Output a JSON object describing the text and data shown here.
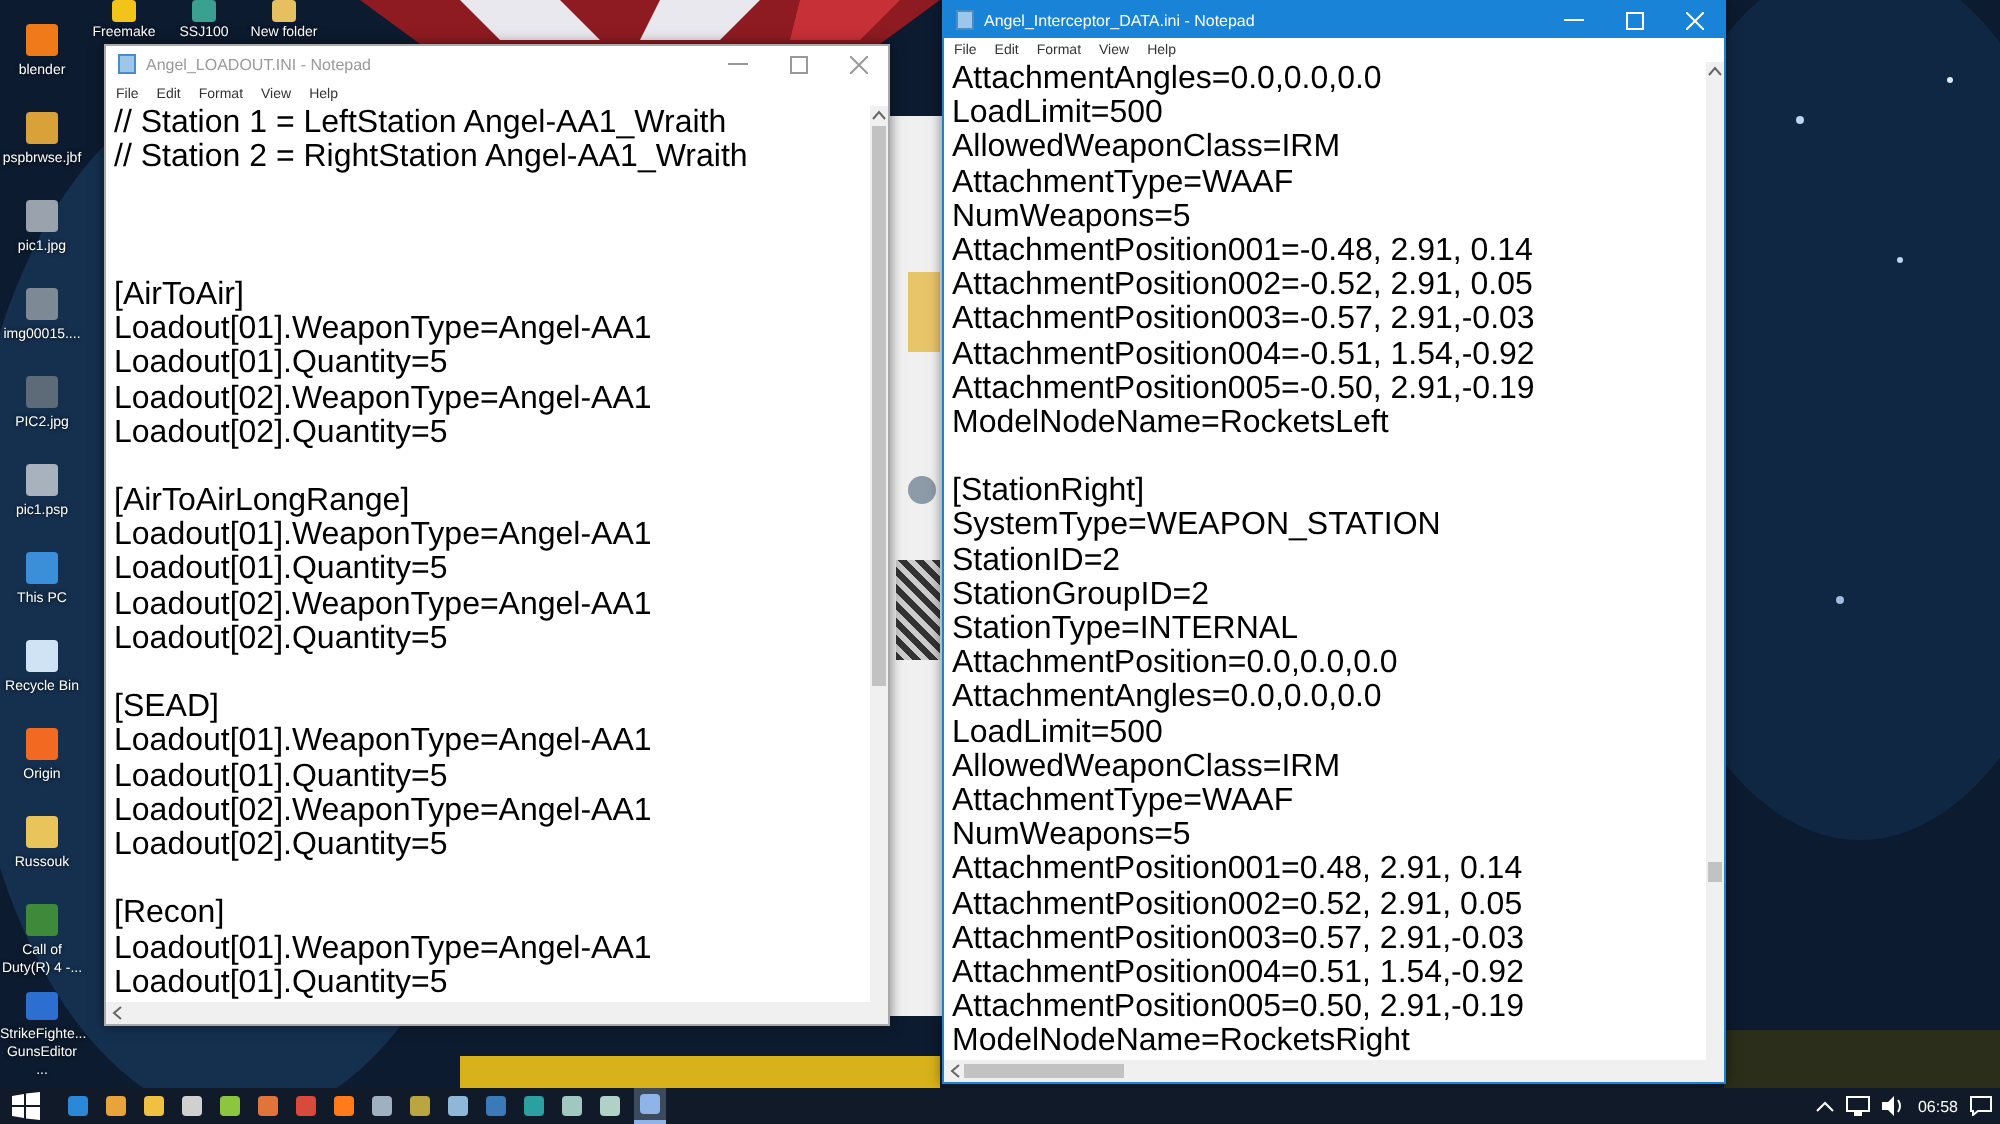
{
  "desktop_icons": [
    {
      "label": "blender",
      "color": "#f07a1a"
    },
    {
      "label": "pspbrwse.jbf",
      "color": "#d9a13a"
    },
    {
      "label": "pic1.jpg",
      "color": "#9aa3ad"
    },
    {
      "label": "img00015....",
      "color": "#7d8a96"
    },
    {
      "label": "PIC2.jpg",
      "color": "#5d6b78"
    },
    {
      "label": "pic1.psp",
      "color": "#a8b2bc"
    },
    {
      "label": "This PC",
      "color": "#3a8fd8"
    },
    {
      "label": "Recycle Bin",
      "color": "#cfe3f5"
    },
    {
      "label": "Origin",
      "color": "#f26a21"
    },
    {
      "label": "Russouk",
      "color": "#e8c45a"
    },
    {
      "label": "Call of Duty(R) 4 -...",
      "color": "#3f8a3a"
    },
    {
      "label": "StrikeFighte... GunsEditor ...",
      "color": "#2d6fd0"
    }
  ],
  "top_icons": [
    {
      "label": "Freemake",
      "color": "#f2c318"
    },
    {
      "label": "SSJ100",
      "color": "#3aa08f"
    },
    {
      "label": "New folder",
      "color": "#e6c060"
    }
  ],
  "windows": [
    {
      "title": "Angel_LOADOUT.INI - Notepad",
      "active": false,
      "menu": [
        "File",
        "Edit",
        "Format",
        "View",
        "Help"
      ],
      "sections": [
        {
          "kind": "header",
          "lines": [
            "// Station 1 = LeftStation Angel-AA1_Wraith",
            "// Station 2 = RightStation Angel-AA1_Wraith"
          ]
        },
        {
          "kind": "block",
          "lines": [
            "[AirToAir]",
            "Loadout[01].WeaponType=Angel-AA1",
            "Loadout[01].Quantity=5",
            "Loadout[02].WeaponType=Angel-AA1",
            "Loadout[02].Quantity=5"
          ]
        },
        {
          "kind": "block",
          "lines": [
            "[AirToAirLongRange]",
            "Loadout[01].WeaponType=Angel-AA1",
            "Loadout[01].Quantity=5",
            "Loadout[02].WeaponType=Angel-AA1",
            "Loadout[02].Quantity=5"
          ]
        },
        {
          "kind": "block",
          "lines": [
            "[SEAD]",
            "Loadout[01].WeaponType=Angel-AA1",
            "Loadout[01].Quantity=5",
            "Loadout[02].WeaponType=Angel-AA1",
            "Loadout[02].Quantity=5"
          ]
        },
        {
          "kind": "block",
          "lines": [
            "[Recon]",
            "Loadout[01].WeaponType=Angel-AA1",
            "Loadout[01].Quantity=5"
          ]
        }
      ]
    },
    {
      "title": "Angel_Interceptor_DATA.ini - Notepad",
      "active": true,
      "menu": [
        "File",
        "Edit",
        "Format",
        "View",
        "Help"
      ],
      "sections": [
        {
          "kind": "block",
          "lines": [
            "AttachmentAngles=0.0,0.0,0.0",
            "LoadLimit=500",
            "AllowedWeaponClass=IRM",
            "AttachmentType=WAAF",
            "NumWeapons=5",
            "AttachmentPosition001=-0.48, 2.91, 0.14",
            "AttachmentPosition002=-0.52, 2.91, 0.05",
            "AttachmentPosition003=-0.57, 2.91,-0.03",
            "AttachmentPosition004=-0.51, 1.54,-0.92",
            "AttachmentPosition005=-0.50, 2.91,-0.19",
            "ModelNodeName=RocketsLeft"
          ]
        },
        {
          "kind": "block",
          "lines": [
            "[StationRight]",
            "SystemType=WEAPON_STATION",
            "StationID=2",
            "StationGroupID=2",
            "StationType=INTERNAL",
            "AttachmentPosition=0.0,0.0,0.0",
            "AttachmentAngles=0.0,0.0,0.0",
            "LoadLimit=500",
            "AllowedWeaponClass=IRM",
            "AttachmentType=WAAF",
            "NumWeapons=5",
            "AttachmentPosition001=0.48, 2.91, 0.14",
            "AttachmentPosition002=0.52, 2.91, 0.05",
            "AttachmentPosition003=0.57, 2.91,-0.03",
            "AttachmentPosition004=0.51, 1.54,-0.92",
            "AttachmentPosition005=0.50, 2.91,-0.19",
            "ModelNodeName=RocketsRight"
          ]
        }
      ]
    }
  ],
  "taskbar": {
    "apps": [
      {
        "color": "#2b88d8",
        "selected": false
      },
      {
        "color": "#e8a33a",
        "selected": false
      },
      {
        "color": "#f0c040",
        "selected": false
      },
      {
        "color": "#d0d0d0",
        "selected": false
      },
      {
        "color": "#8cc63f",
        "selected": false
      },
      {
        "color": "#e0743a",
        "selected": false
      },
      {
        "color": "#d84a3a",
        "selected": false
      },
      {
        "color": "#ff7a1a",
        "selected": false
      },
      {
        "color": "#9fb0c0",
        "selected": false
      },
      {
        "color": "#b9a640",
        "selected": false
      },
      {
        "color": "#8fb8d8",
        "selected": false
      },
      {
        "color": "#3a7ab8",
        "selected": false
      },
      {
        "color": "#2aa0a0",
        "selected": false
      },
      {
        "color": "#a0c8c0",
        "selected": false
      },
      {
        "color": "#b0d0c8",
        "selected": false
      },
      {
        "color": "#8fb4e8",
        "selected": true
      }
    ],
    "clock": "06:58"
  }
}
